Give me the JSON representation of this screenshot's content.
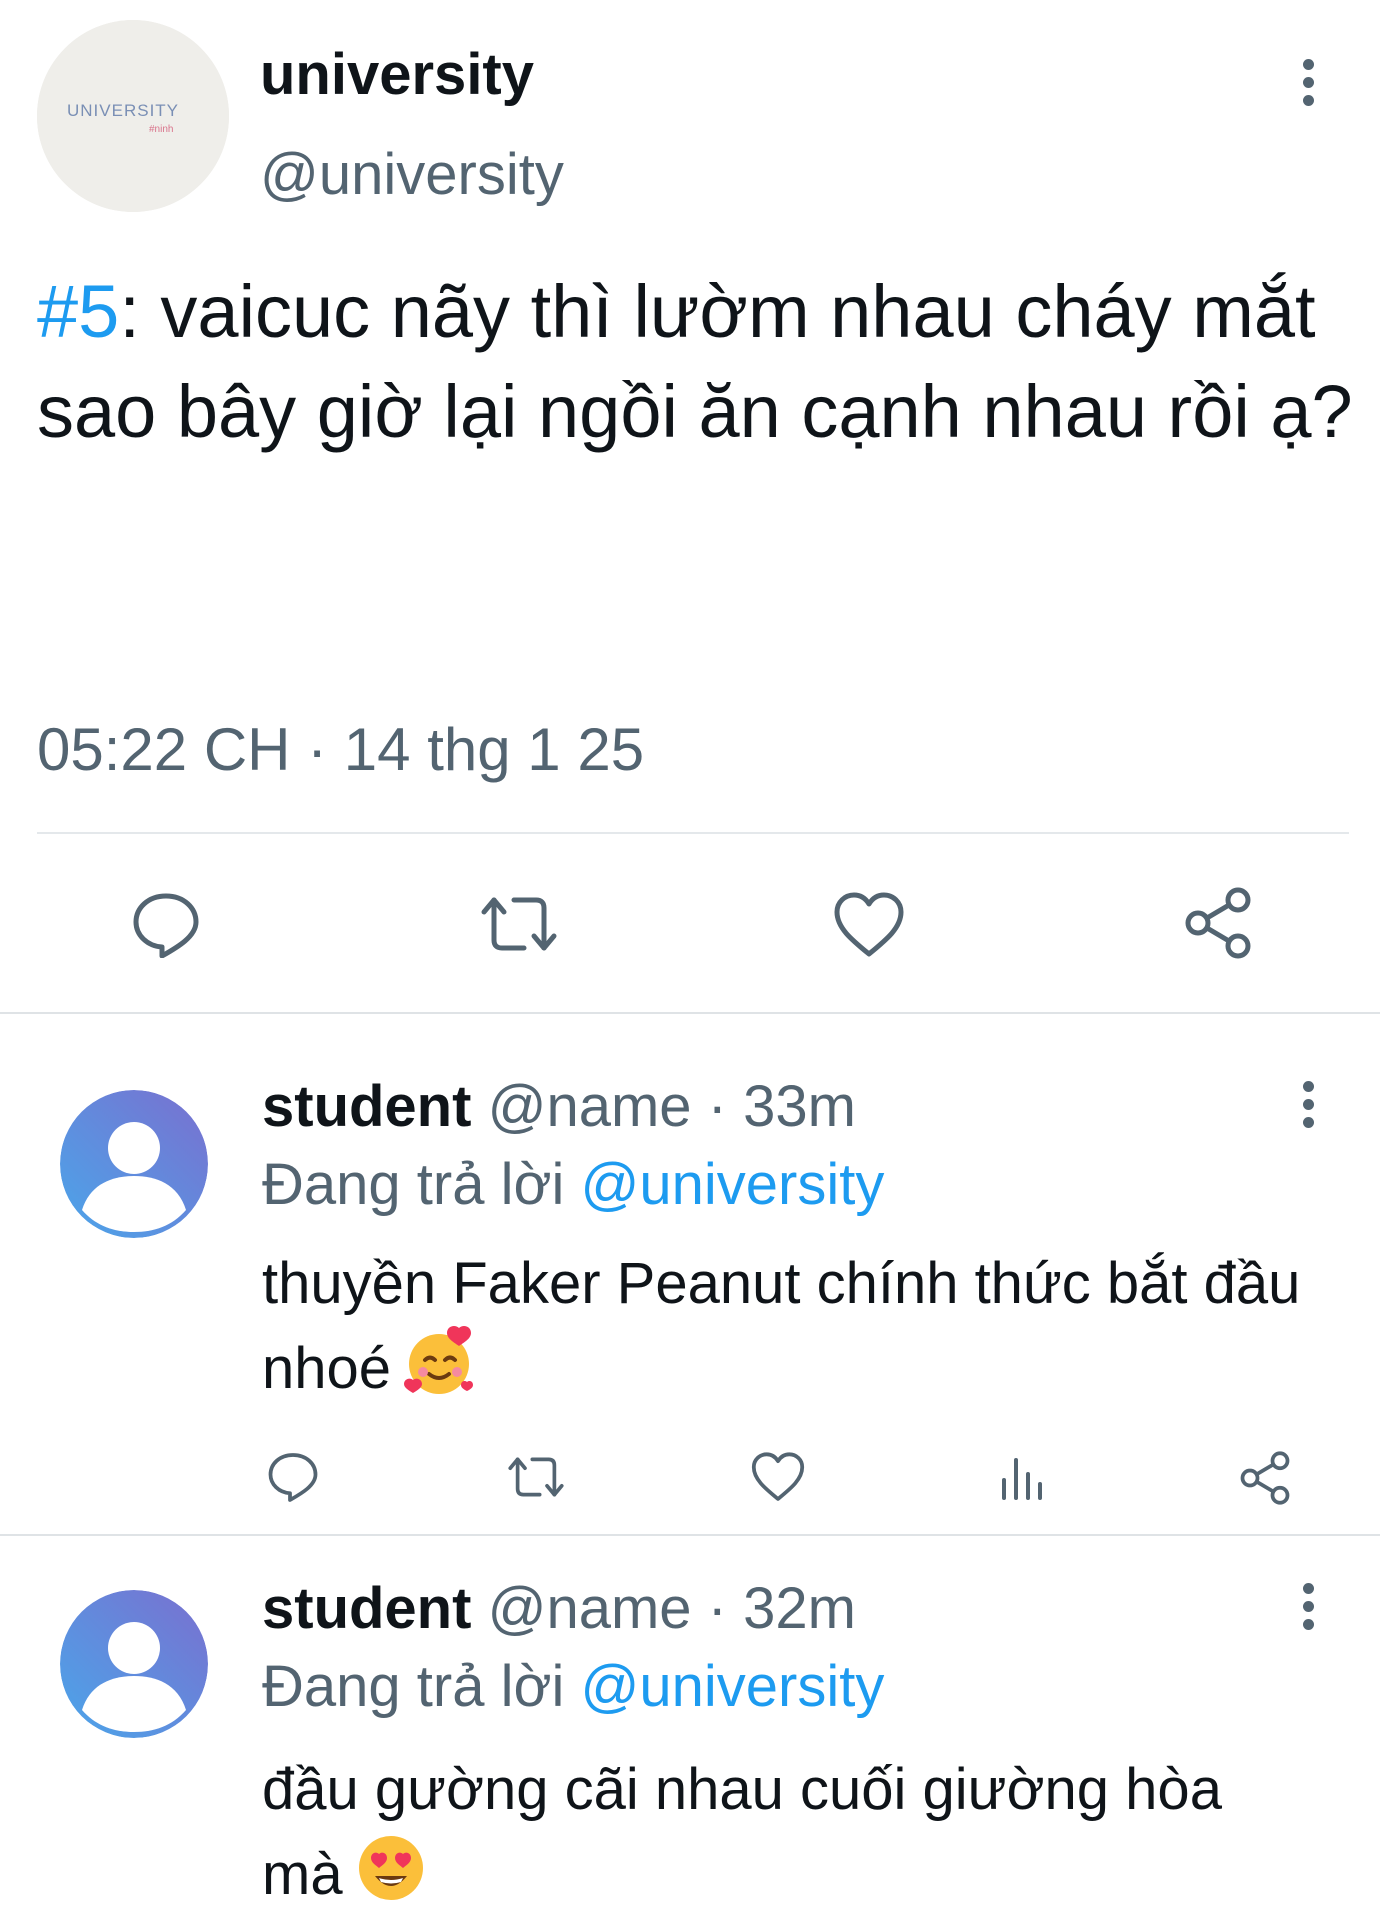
{
  "main_tweet": {
    "avatar": {
      "text": "UNIVERSITY",
      "subtext": "#ninh"
    },
    "display_name": "university",
    "handle": "@university",
    "hashtag": "#5",
    "text_after_hashtag": ": vaicuc nãy thì lườm nhau cháy mắt",
    "text_line2": "sao bây giờ lại ngồi ăn cạnh nhau rồi ạ?",
    "timestamp": "05:22 CH · 14 thg 1 25",
    "actions": [
      "reply-icon",
      "retweet-icon",
      "like-icon",
      "share-icon"
    ]
  },
  "replies": [
    {
      "name": "student",
      "handle": "@name",
      "time": "· 33m",
      "replying_label": "Đang trả lời",
      "replying_to": "@university",
      "text": "thuyền Faker Peanut chính thức bắt đầu nhoé",
      "emoji": "smiling-face-with-hearts",
      "actions": [
        "reply-icon",
        "retweet-icon",
        "like-icon",
        "views-icon",
        "share-icon"
      ]
    },
    {
      "name": "student",
      "handle": "@name",
      "time": "· 32m",
      "replying_label": "Đang trả lời",
      "replying_to": "@university",
      "text": "đầu gường cãi nhau cuối giường hòa mà",
      "emoji": "heart-eyes-face"
    }
  ],
  "colors": {
    "link": "#1d9bf0",
    "muted": "#536471",
    "text": "#0f1419"
  }
}
